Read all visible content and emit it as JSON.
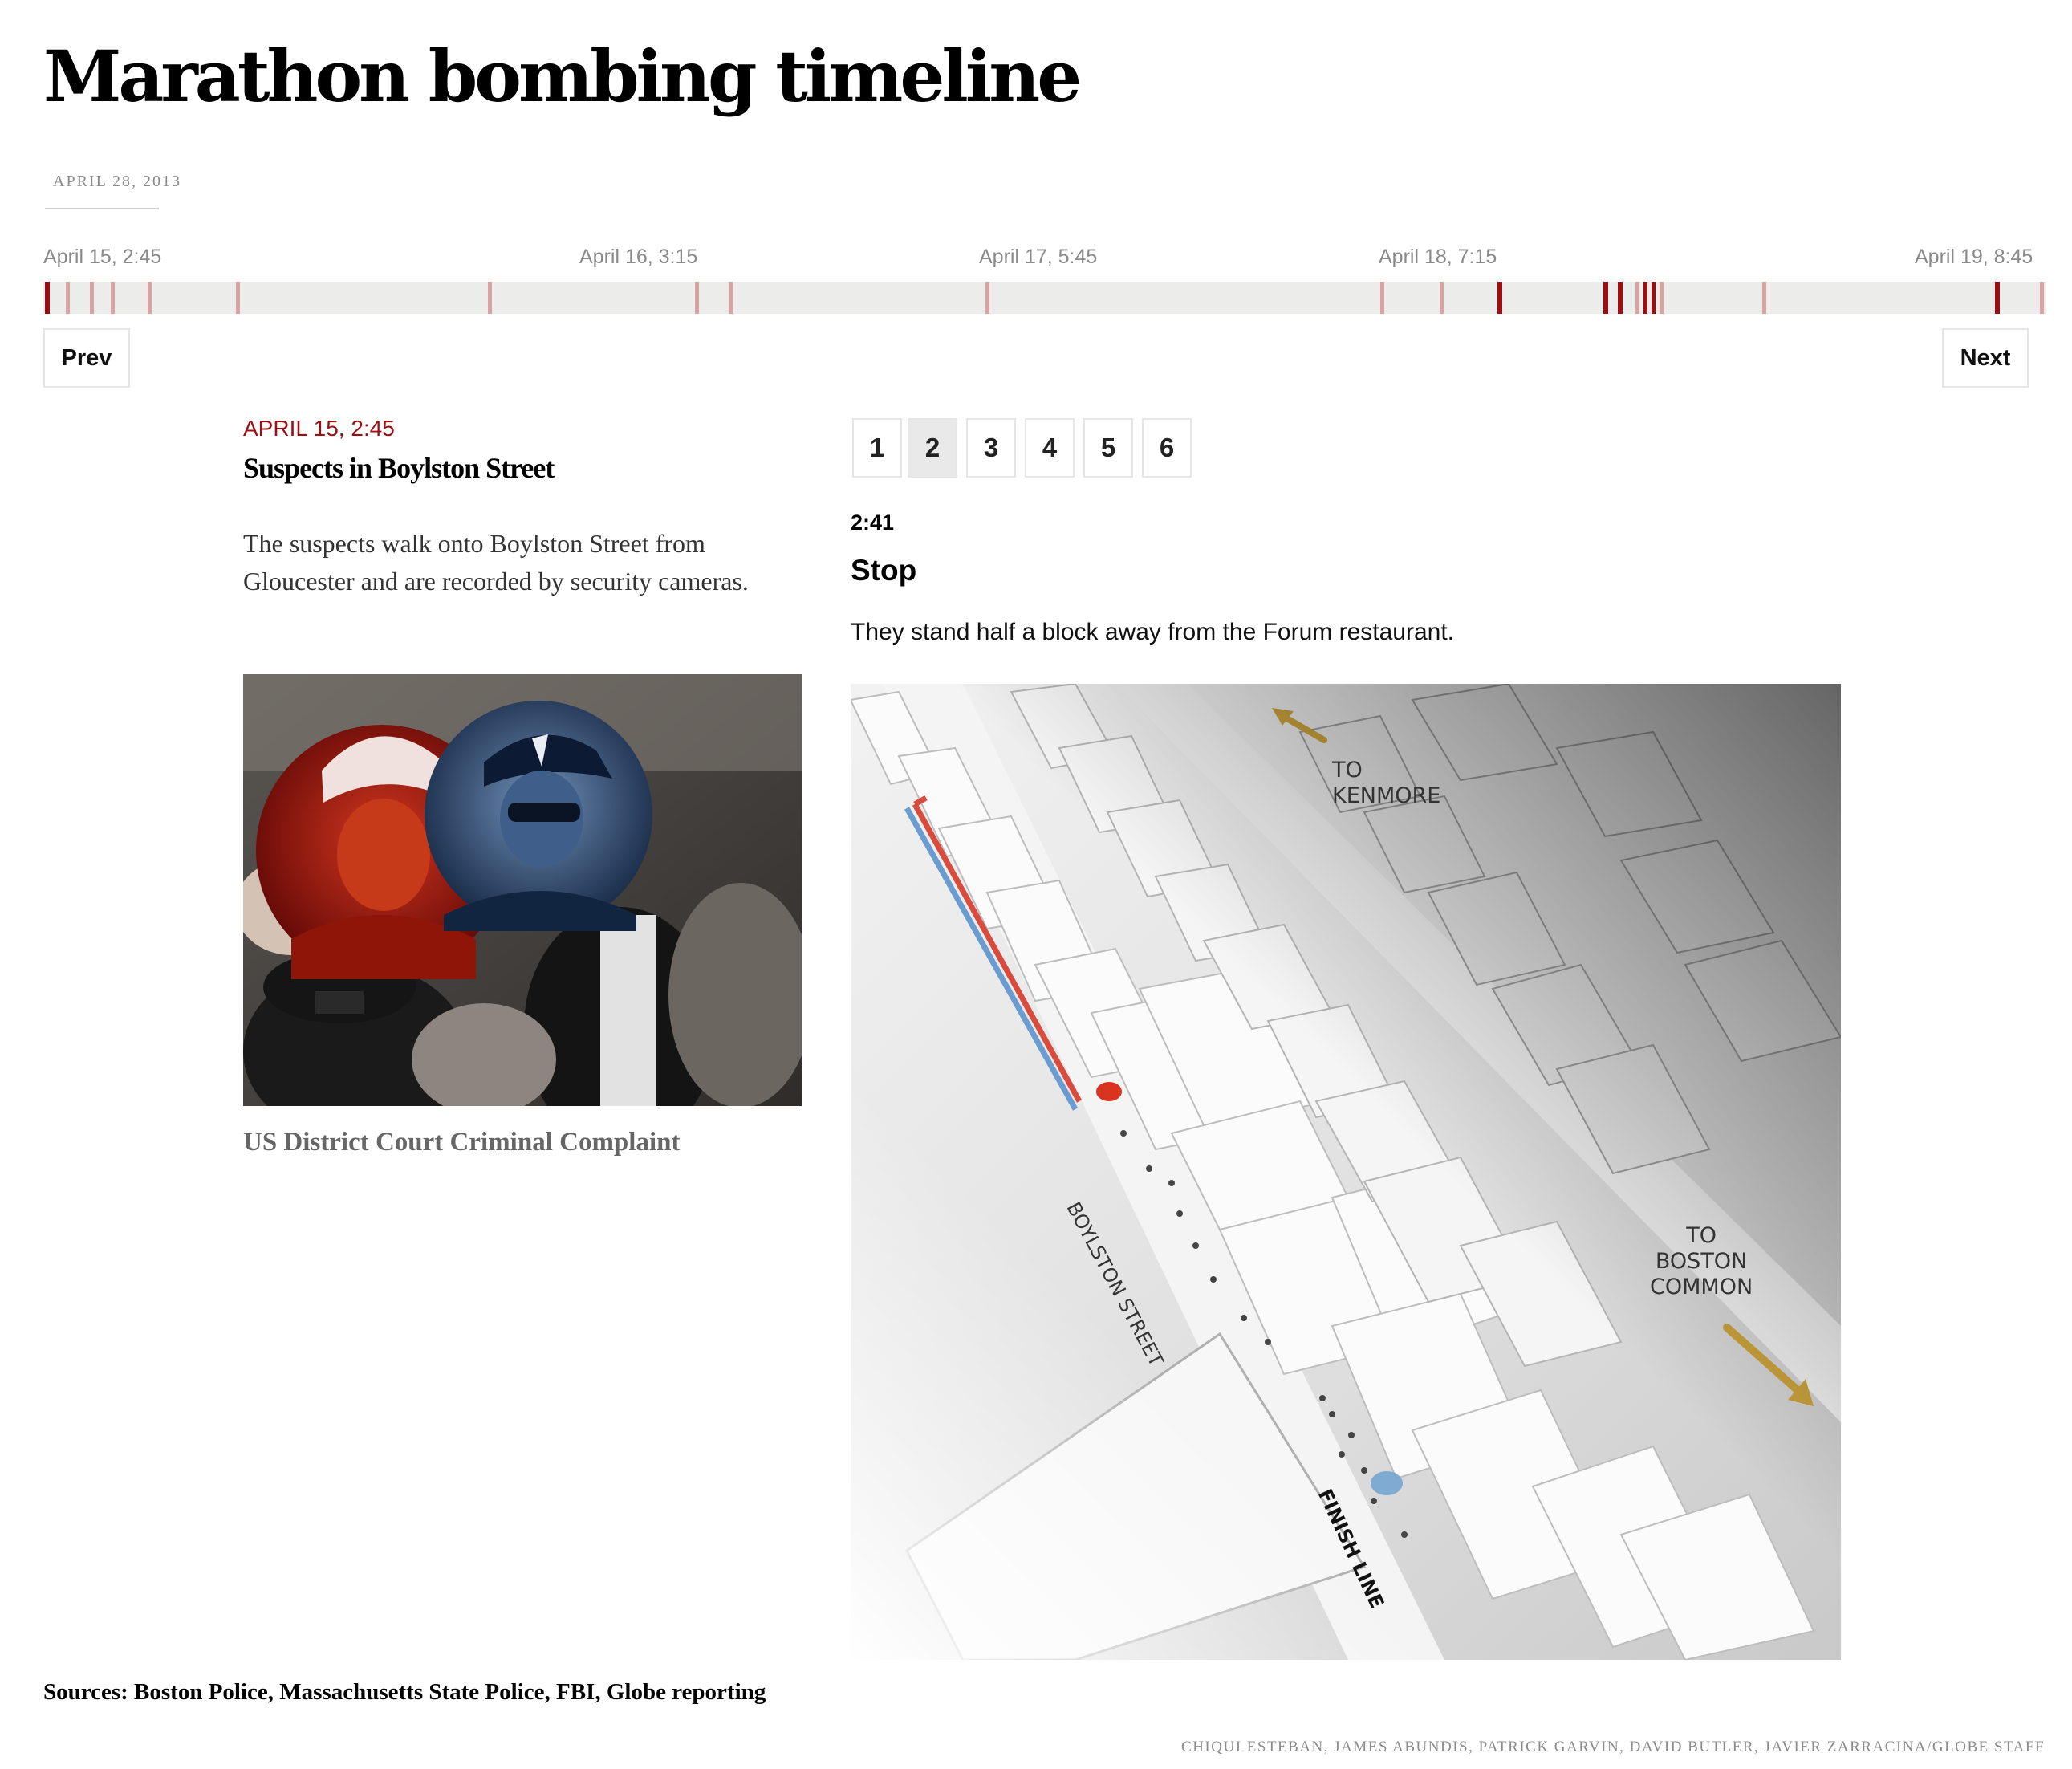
{
  "page": {
    "title": "Marathon bombing timeline",
    "date": "APRIL 28, 2013"
  },
  "timeline": {
    "tick_labels": [
      "April 15, 2:45",
      "April 16, 3:15",
      "April 17, 5:45",
      "April 18, 7:15",
      "April 19, 8:45"
    ],
    "accent_color": "#9b0f12",
    "muted_color": "#d9a2a3"
  },
  "nav": {
    "prev_label": "Prev",
    "next_label": "Next"
  },
  "event": {
    "date": "APRIL 15, 2:45",
    "title": "Suspects in Boylston Street",
    "description": "The suspects walk onto Boylston Street from Gloucester and are recorded by security cameras.",
    "photo_caption": "US District Court Criminal Complaint"
  },
  "steps": {
    "labels": [
      "1",
      "2",
      "3",
      "4",
      "5",
      "6"
    ],
    "active_index": 1,
    "current": {
      "time": "2:41",
      "title": "Stop",
      "description": "They stand half a block away from the Forum restaurant."
    }
  },
  "map": {
    "labels": {
      "kenmore": "TO\nKENMORE",
      "boston_common": "TO\nBOSTON\nCOMMON",
      "boylston": "BOYLSTON STREET",
      "finish_line": "FINISH LINE"
    }
  },
  "footer": {
    "sources": "Sources: Boston Police, Massachusetts State Police, FBI, Globe reporting",
    "credit": "CHIQUI ESTEBAN, JAMES ABUNDIS, PATRICK GARVIN, DAVID BUTLER, JAVIER ZARRACINA/GLOBE STAFF"
  }
}
